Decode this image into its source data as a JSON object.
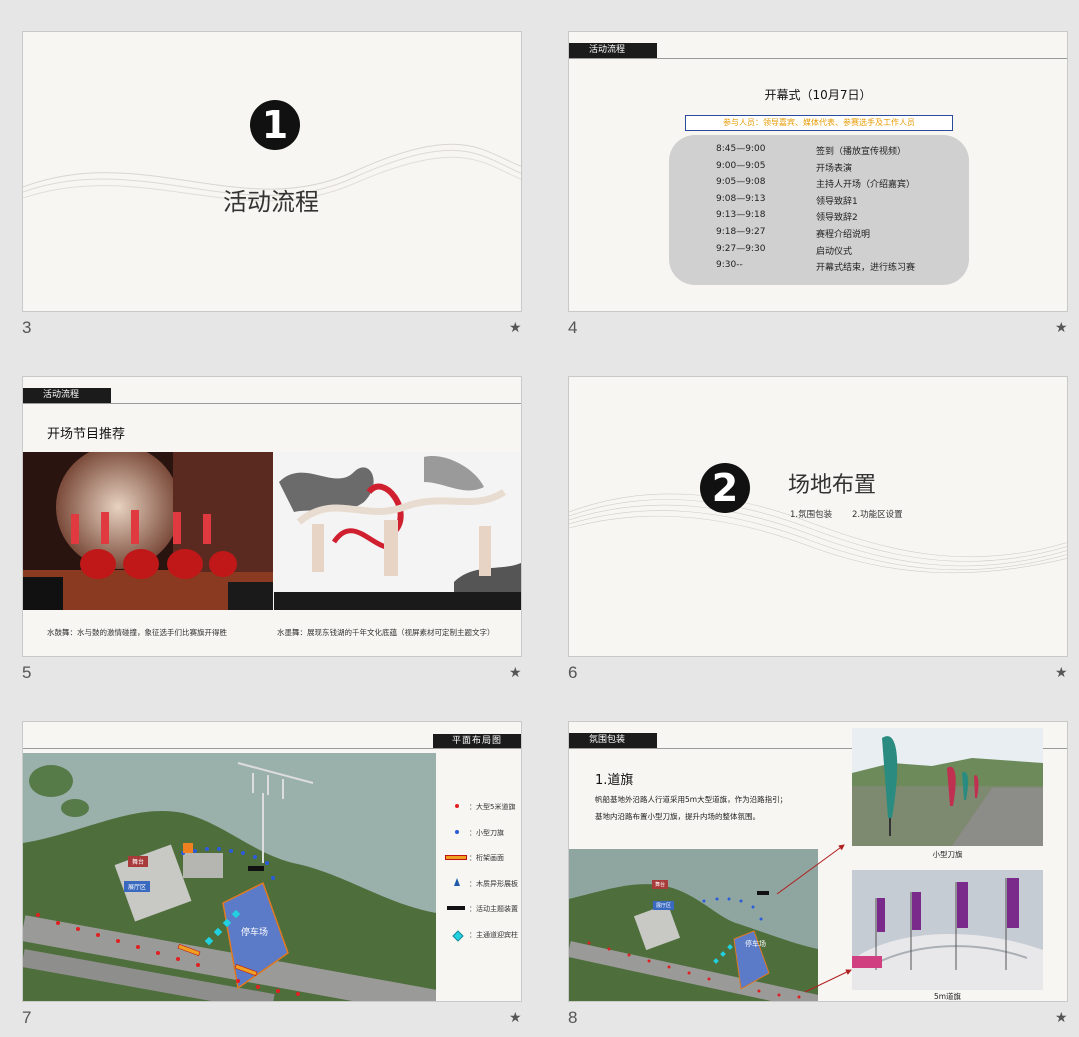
{
  "slides": [
    {
      "number": "3",
      "heading": "活动流程",
      "circle_num": "1"
    },
    {
      "number": "4",
      "tag": "活动流程",
      "title": "开幕式（10月7日）",
      "participants": "参与人员：领导嘉宾、媒体代表、参赛选手及工作人员",
      "schedule": [
        {
          "time": "8:45—9:00",
          "item": "签到（播放宣传视频）"
        },
        {
          "time": "9:00—9:05",
          "item": "开场表演"
        },
        {
          "time": "9:05—9:08",
          "item": "主持人开场（介绍嘉宾）"
        },
        {
          "time": "9:08—9:13",
          "item": "领导致辞1"
        },
        {
          "time": "9:13—9:18",
          "item": "领导致辞2"
        },
        {
          "time": "9:18—9:27",
          "item": "赛程介绍说明"
        },
        {
          "time": "9:27—9:30",
          "item": "启动仪式"
        },
        {
          "time": "9:30--",
          "item": "开幕式结束，进行练习赛"
        }
      ]
    },
    {
      "number": "5",
      "tag": "活动流程",
      "title": "开场节目推荐",
      "caption_left": "水鼓舞：水与鼓的激情碰撞，象征选手们比赛旗开得胜",
      "caption_right": "水墨舞：展现东钱湖的千年文化底蕴（视屏素材可定制主题文字）"
    },
    {
      "number": "6",
      "circle_num": "2",
      "heading": "场地布置",
      "sub1": "1.氛围包装",
      "sub2": "2.功能区设置"
    },
    {
      "number": "7",
      "tag": "平面布局图",
      "map_stage": "舞台",
      "map_exhibit": "展厅区",
      "map_parking": "停车场",
      "legend": [
        {
          "label": "：大型5米道旗",
          "color": "#e02020",
          "shape": "dot"
        },
        {
          "label": "：小型刀旗",
          "color": "#2a5bd8",
          "shape": "dot"
        },
        {
          "label": "：桁架画面",
          "color": "#f0a020",
          "shape": "bar"
        },
        {
          "label": "：木质异形展板",
          "color": "#1e5aa8",
          "shape": "tri"
        },
        {
          "label": "：活动主题装置",
          "color": "#111111",
          "shape": "blackbar"
        },
        {
          "label": "：主通道迎宾柱",
          "color": "#22d0e0",
          "shape": "diamond"
        }
      ]
    },
    {
      "number": "8",
      "tag": "氛围包装",
      "title": "1.道旗",
      "body1": "帆船基地外沿路人行道采用5m大型道旗，作为沿路指引；",
      "body2": "基地内沿路布置小型刀旗，提升内场的整体氛围。",
      "photo_top_label": "小型刀旗",
      "photo_bottom_label": "5m道旗",
      "map_stage": "舞台",
      "map_exhibit": "展厅区",
      "map_parking": "停车场"
    }
  ],
  "star_icon": "★"
}
